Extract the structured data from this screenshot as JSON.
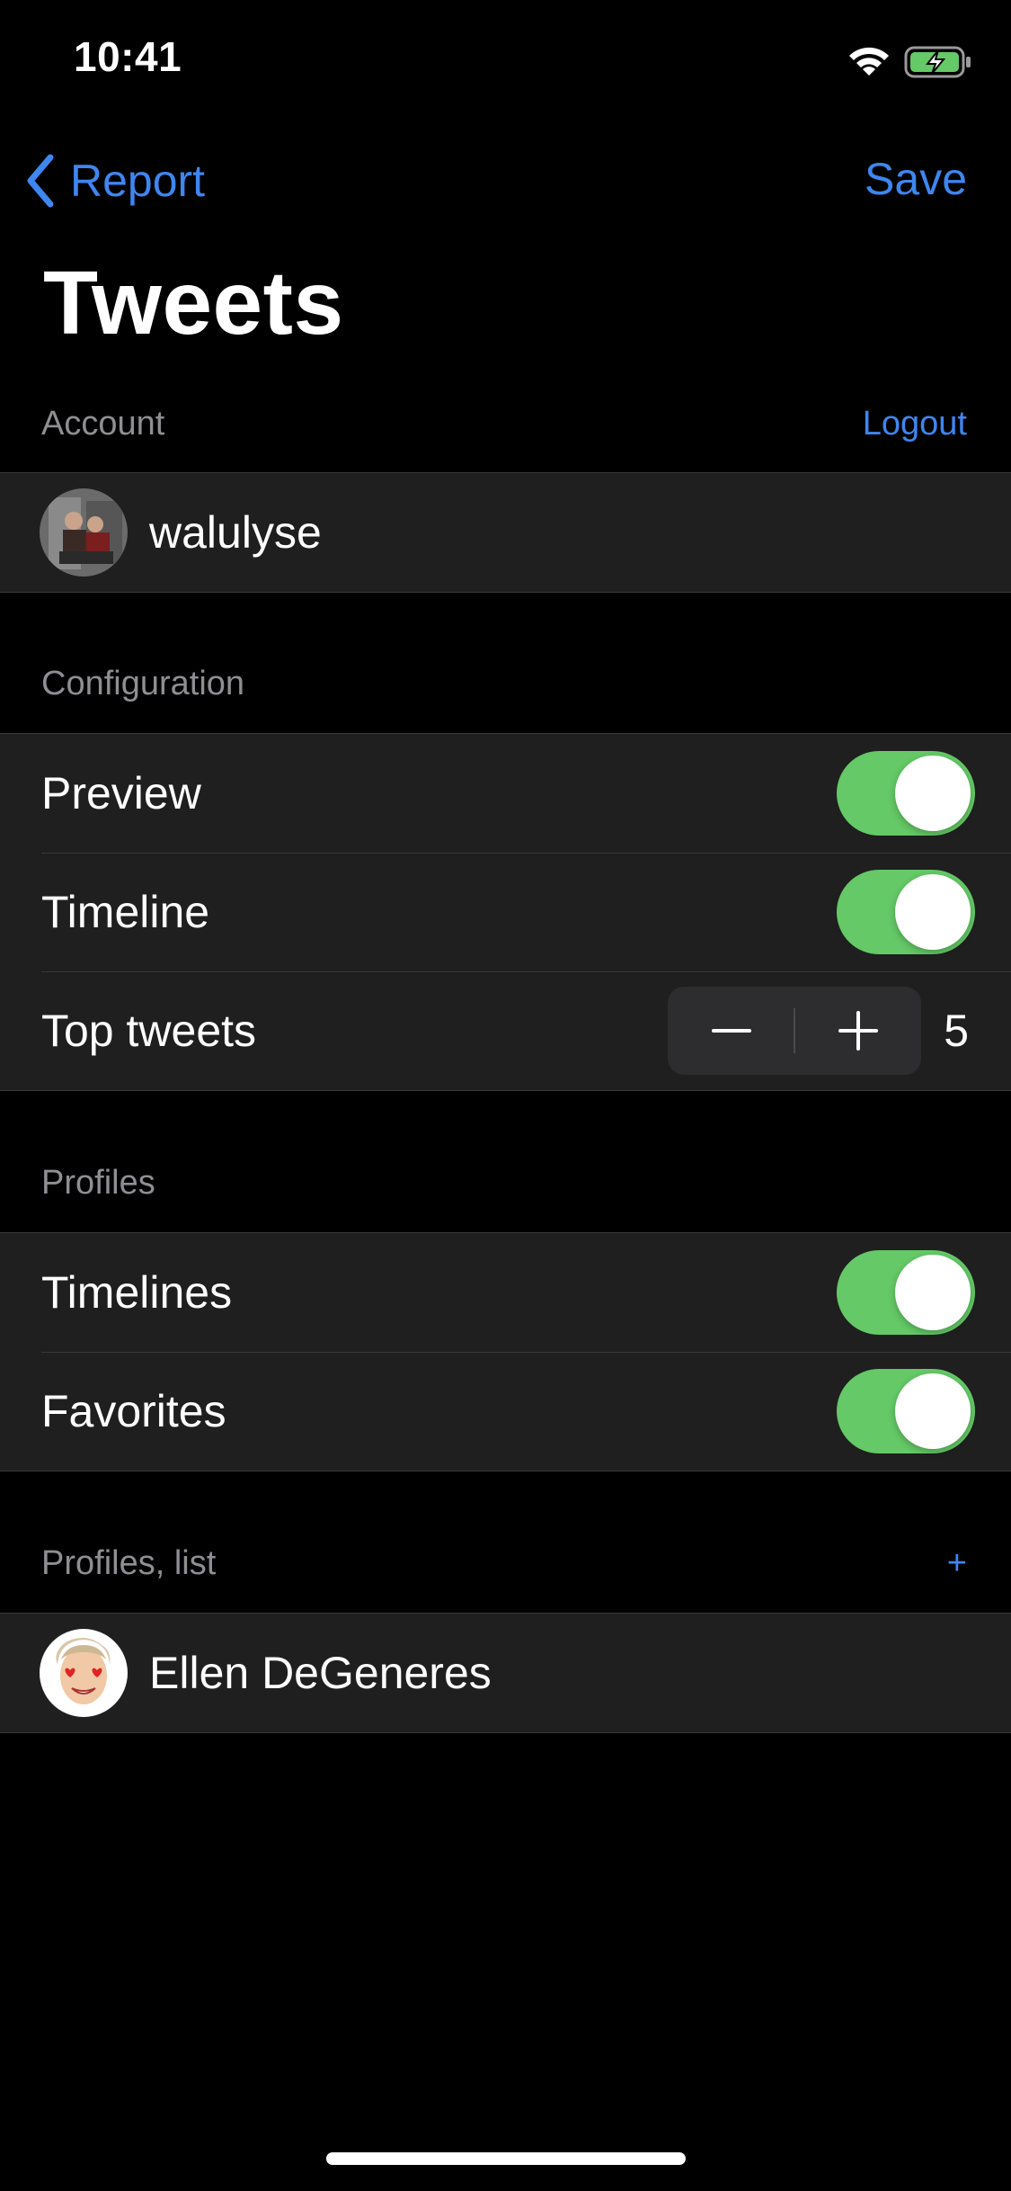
{
  "status_bar": {
    "time": "10:41",
    "wifi_icon": "wifi-icon",
    "battery_icon": "battery-charging-icon",
    "battery_color": "#64c966"
  },
  "nav": {
    "back_label": "Report",
    "back_icon": "chevron-left-icon",
    "save_label": "Save",
    "title": "Tweets"
  },
  "account": {
    "header": "Account",
    "action_label": "Logout",
    "username": "walulyse"
  },
  "configuration": {
    "header": "Configuration",
    "rows": [
      {
        "label": "Preview",
        "on": true
      },
      {
        "label": "Timeline",
        "on": true
      }
    ],
    "top_tweets": {
      "label": "Top tweets",
      "value": "5",
      "decrement_icon": "minus-icon",
      "increment_icon": "plus-icon"
    }
  },
  "profiles": {
    "header": "Profiles",
    "rows": [
      {
        "label": "Timelines",
        "on": true
      },
      {
        "label": "Favorites",
        "on": true
      }
    ]
  },
  "profiles_list": {
    "header": "Profiles, list",
    "add_label": "+",
    "items": [
      {
        "name": "Ellen DeGeneres"
      }
    ]
  },
  "colors": {
    "background": "#000000",
    "cell": "#1f1f1f",
    "accent": "#3e86f0",
    "toggle_on": "#64c966",
    "secondary_text": "#8e8e93"
  }
}
